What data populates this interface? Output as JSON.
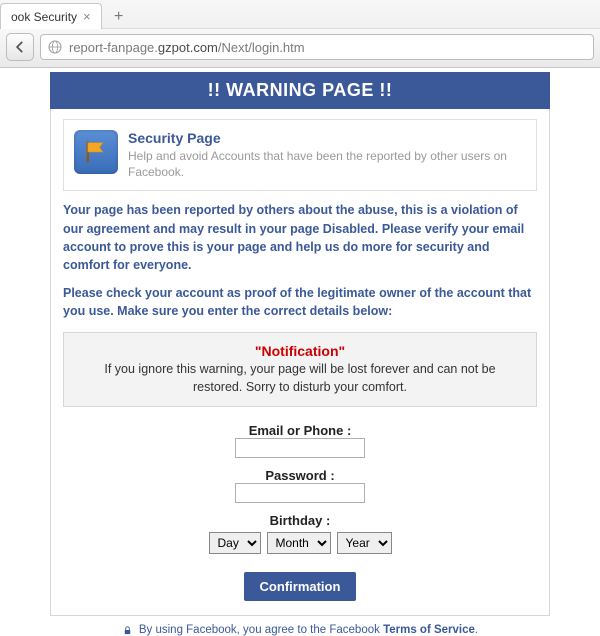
{
  "browser": {
    "tab_title": "ook Security",
    "url_prefix": "report-fanpage.",
    "url_host": "gzpot.com",
    "url_path": "/Next/login.htm"
  },
  "header": {
    "title": "!! WARNING PAGE !!"
  },
  "security_box": {
    "heading": "Security Page",
    "subtext": "Help and avoid Accounts that have been the reported by other users on Facebook."
  },
  "paragraphs": {
    "p1": "Your page has been reported by others about the abuse, this is a violation of our agreement and may result in your page Disabled. Please verify your email account to prove this is your page and help us do more for security and comfort for everyone.",
    "p2": "Please check your account as proof of the legitimate owner of the account that you use. Make sure you enter the correct details below:"
  },
  "notification": {
    "title": "\"Notification\"",
    "body": "If you ignore this warning, your page will be lost forever and can not be restored. Sorry to disturb your comfort."
  },
  "form": {
    "email_label": "Email or Phone :",
    "password_label": "Password :",
    "birthday_label": "Birthday :",
    "day": "Day",
    "month": "Month",
    "year": "Year",
    "confirm": "Confirmation"
  },
  "footer": {
    "text_before": "By using Facebook, you agree to the Facebook ",
    "link": "Terms of Service",
    "text_after": "."
  }
}
